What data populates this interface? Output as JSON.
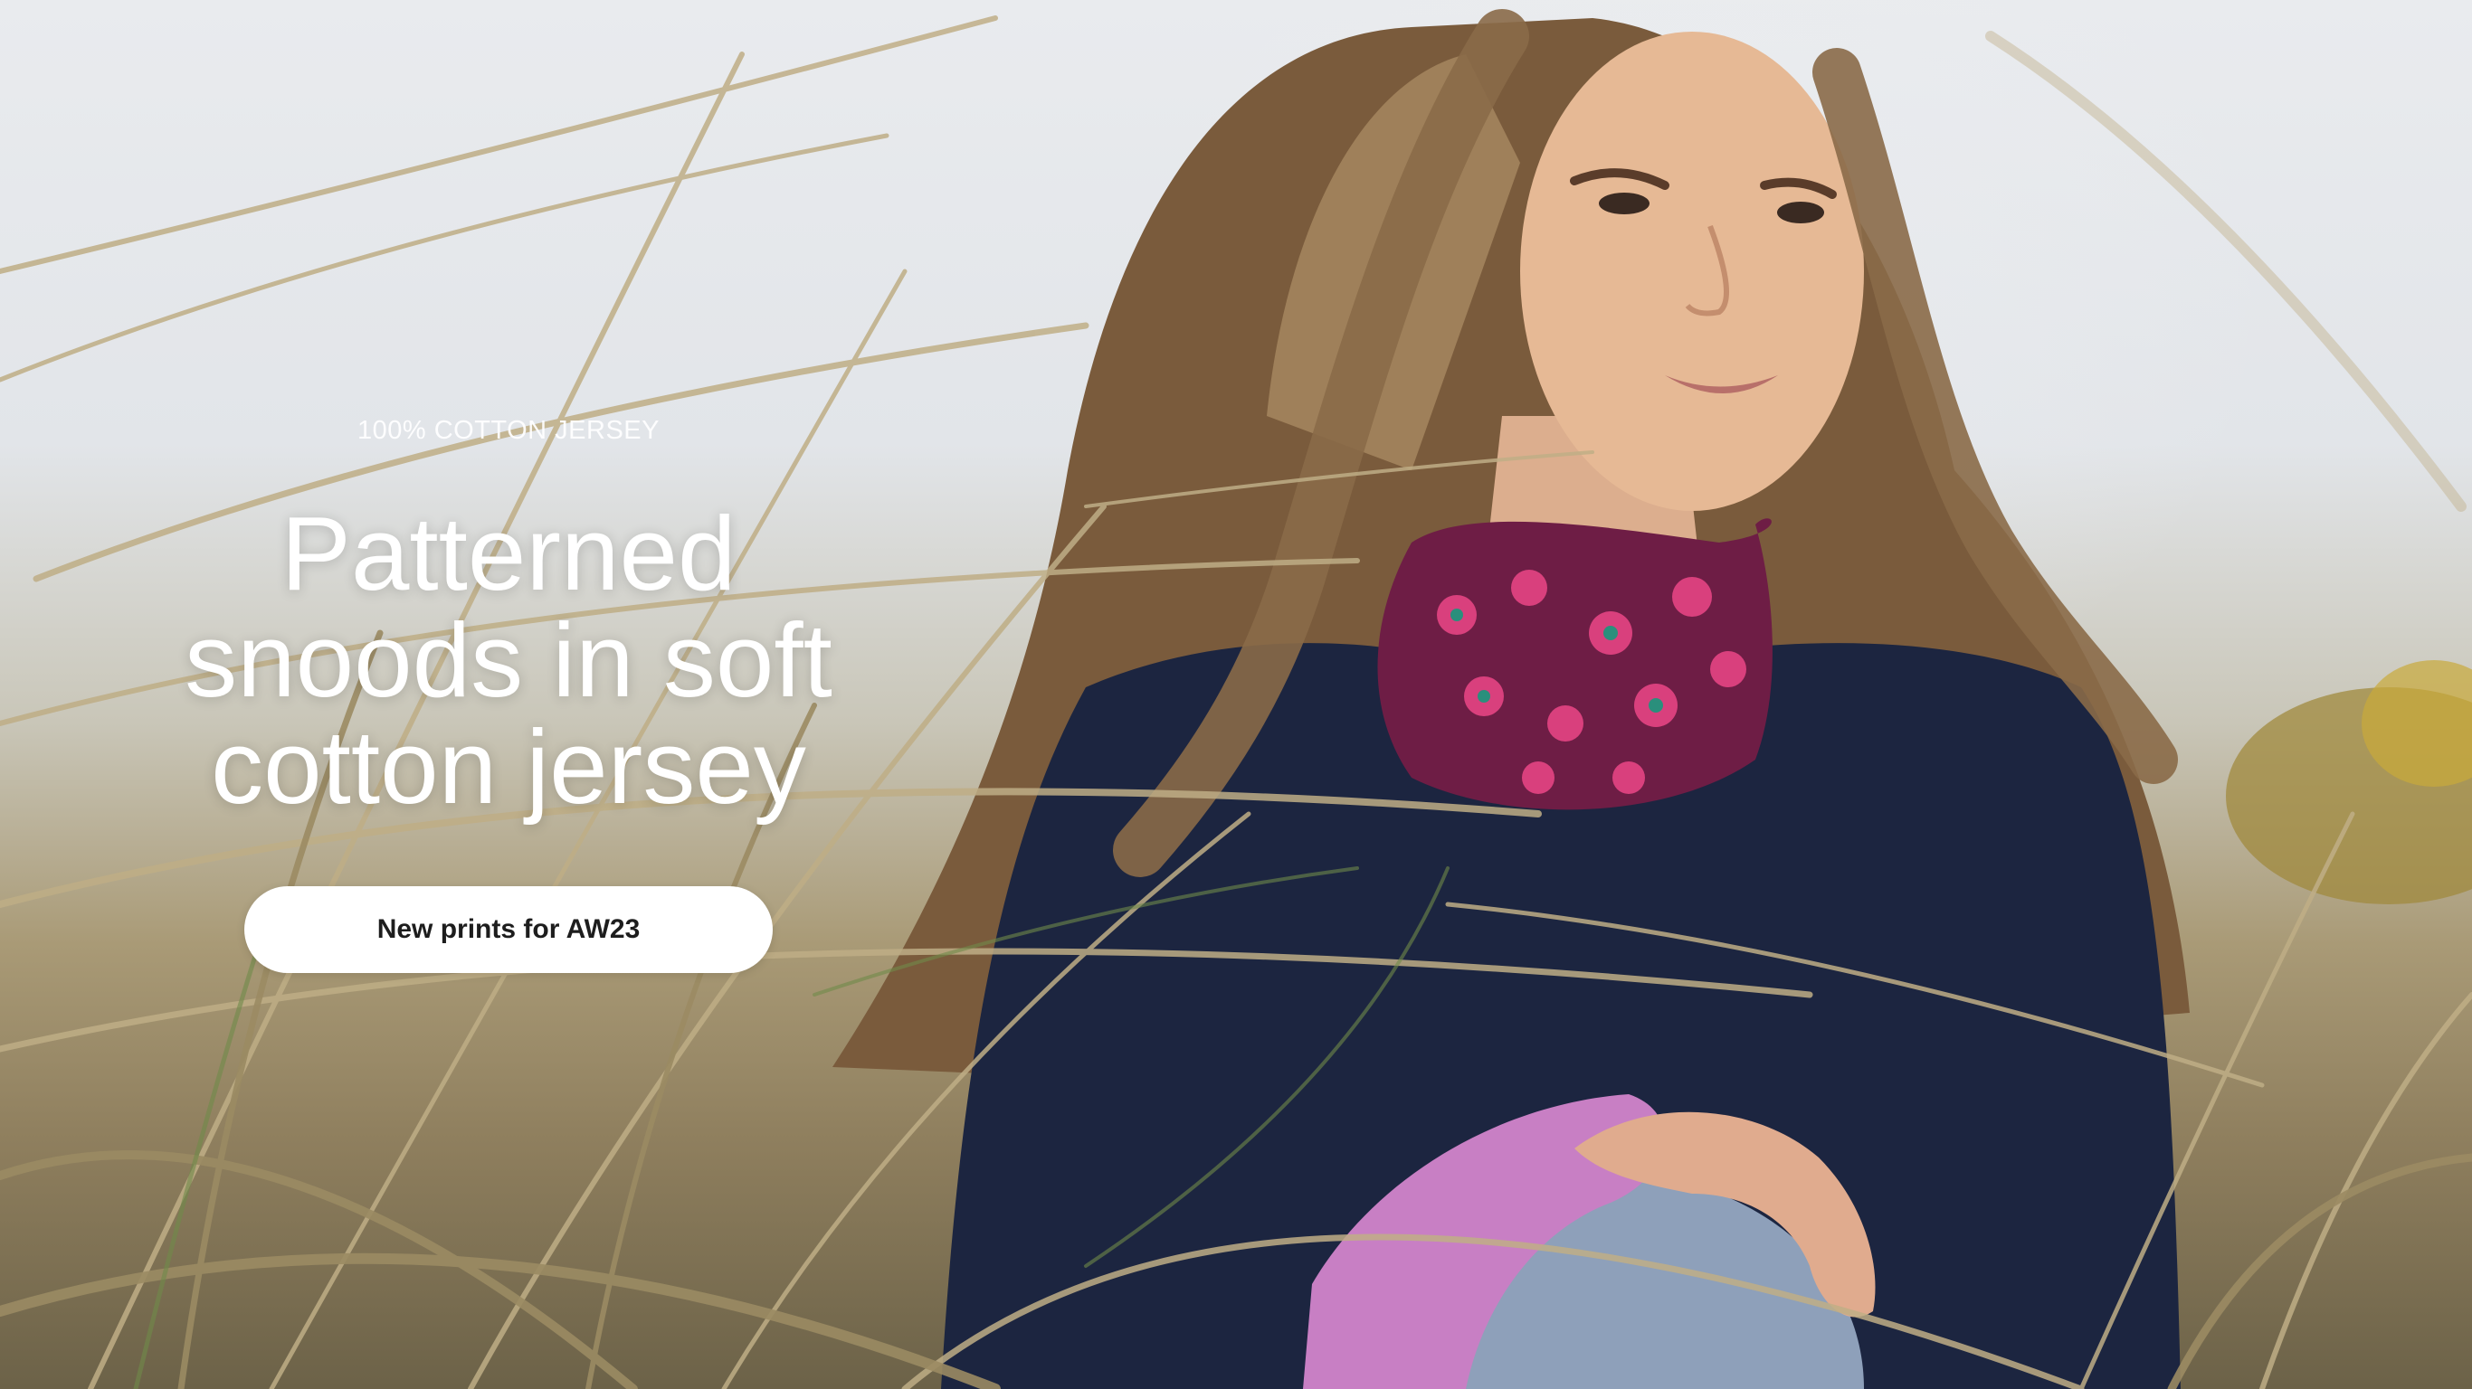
{
  "hero": {
    "eyebrow": "100% COTTON JERSEY",
    "headline": "Patterned snoods in soft cotton jersey",
    "cta_label": "New prints for AW23"
  },
  "colors": {
    "text": "#ffffff",
    "button_bg": "#ffffff",
    "button_text": "#1d1d1d",
    "sweater": "#1c2540",
    "snood": "#6e1d45",
    "snood_print": "#d9407d",
    "mitten": "#c87fc4",
    "grass": "#b4a27c"
  }
}
